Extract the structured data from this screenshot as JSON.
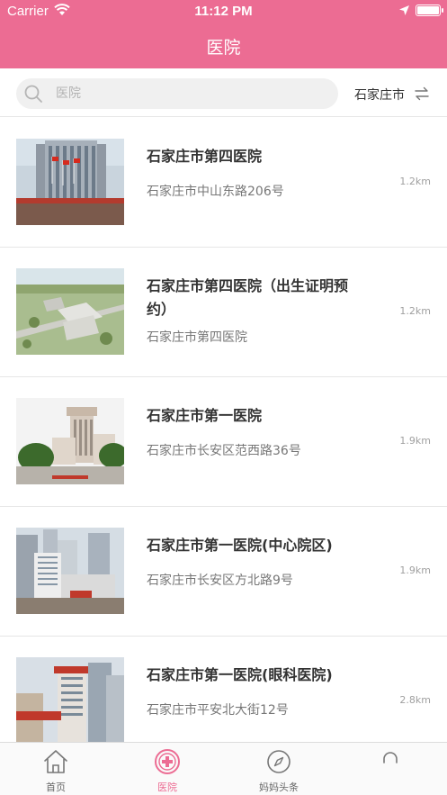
{
  "status_bar": {
    "carrier": "Carrier",
    "time": "11:12 PM"
  },
  "header": {
    "title": "医院"
  },
  "search": {
    "placeholder": "医院",
    "city": "石家庄市"
  },
  "hospitals": [
    {
      "name": "石家庄市第四医院",
      "address": "石家庄市中山东路206号",
      "distance": "1.2km"
    },
    {
      "name": "石家庄市第四医院（出生证明预约）",
      "address": "石家庄市第四医院",
      "distance": "1.2km"
    },
    {
      "name": "石家庄市第一医院",
      "address": "石家庄市长安区范西路36号",
      "distance": "1.9km"
    },
    {
      "name": "石家庄市第一医院(中心院区)",
      "address": "石家庄市长安区方北路9号",
      "distance": "1.9km"
    },
    {
      "name": "石家庄市第一医院(眼科医院)",
      "address": "石家庄市平安北大街12号",
      "distance": "2.8km"
    }
  ],
  "tabbar": {
    "items": [
      {
        "label": "首页",
        "icon": "home-icon"
      },
      {
        "label": "医院",
        "icon": "hospital-cross-icon",
        "active": true
      },
      {
        "label": "妈妈头条",
        "icon": "compass-icon"
      },
      {
        "label": "",
        "icon": "profile-icon"
      }
    ]
  },
  "colors": {
    "accent": "#ec6c93",
    "divider": "#e6e6e6",
    "search_bg": "#f0f0f0"
  }
}
